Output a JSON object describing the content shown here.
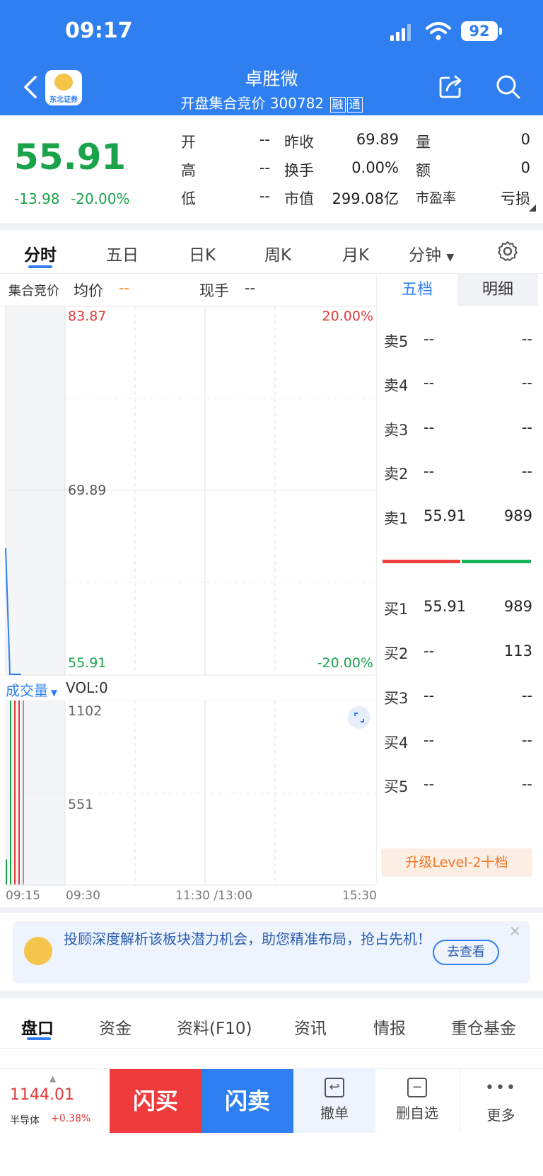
{
  "status_bar": {
    "time": "09:17",
    "battery": "92"
  },
  "header": {
    "title": "卓胜微",
    "subtitle": "开盘集合竞价 300782",
    "tag1": "融",
    "tag2": "通",
    "logo_text": "东北证券"
  },
  "quote": {
    "price": "55.91",
    "change": "-13.98",
    "change_pct": "-20.00%",
    "fields": {
      "open_label": "开",
      "open": "--",
      "high_label": "高",
      "high": "--",
      "low_label": "低",
      "low": "--",
      "prev_close_label": "昨收",
      "prev_close": "69.89",
      "turnover_label": "换手",
      "turnover": "0.00%",
      "mktcap_label": "市值",
      "mktcap": "299.08亿",
      "volume_label": "量",
      "volume": "0",
      "amount_label": "额",
      "amount": "0",
      "pe_label": "市盈率",
      "pe": "亏损"
    }
  },
  "tabs": [
    "分时",
    "五日",
    "日K",
    "周K",
    "月K",
    "分钟"
  ],
  "chart_info": {
    "auction_label": "集合竞价",
    "avg_label": "均价",
    "avg_value": "--",
    "hand_label": "现手",
    "hand_value": "--"
  },
  "chart_data": {
    "type": "line",
    "y_left_ticks": [
      "83.87",
      "69.89",
      "55.91"
    ],
    "y_right_ticks": [
      "20.00%",
      "-20.00%"
    ],
    "x_ticks": [
      "09:15",
      "09:30",
      "11:30 /13:00",
      "15:30"
    ],
    "ylim": [
      55.91,
      83.87
    ],
    "series": [
      {
        "values": [
          65.5,
          55.91
        ]
      }
    ],
    "volume": {
      "label": "成交量",
      "vol_text": "VOL:0",
      "ticks": [
        "1102",
        "551"
      ],
      "ylim": [
        0,
        1102
      ],
      "bars": [
        {
          "value": 150,
          "color": "#1aa34a"
        },
        {
          "value": 1102,
          "color": "#1aa34a"
        },
        {
          "value": 1102,
          "color": "#e13b3b"
        },
        {
          "value": 1102,
          "color": "#e13b3b"
        },
        {
          "value": 1102,
          "color": "#999999"
        }
      ]
    }
  },
  "orderbook": {
    "tab_five": "五档",
    "tab_detail": "明细",
    "sells": [
      {
        "label": "卖5",
        "price": "--",
        "vol": "--"
      },
      {
        "label": "卖4",
        "price": "--",
        "vol": "--"
      },
      {
        "label": "卖3",
        "price": "--",
        "vol": "--"
      },
      {
        "label": "卖2",
        "price": "--",
        "vol": "--"
      },
      {
        "label": "卖1",
        "price": "55.91",
        "vol": "989"
      }
    ],
    "buys": [
      {
        "label": "买1",
        "price": "55.91",
        "vol": "989"
      },
      {
        "label": "买2",
        "price": "--",
        "vol": "113"
      },
      {
        "label": "买3",
        "price": "--",
        "vol": "--"
      },
      {
        "label": "买4",
        "price": "--",
        "vol": "--"
      },
      {
        "label": "买5",
        "price": "--",
        "vol": "--"
      }
    ],
    "upgrade": "升级Level-2十档"
  },
  "promo": {
    "text": "投顾深度解析该板块潜力机会，助您精准布局，抢占先机！",
    "button": "去查看"
  },
  "bottom_tabs": [
    "盘口",
    "资金",
    "资料(F10)",
    "资讯",
    "情报",
    "重仓基金"
  ],
  "bottom_bar": {
    "index_value": "1144.01",
    "index_name": "半导体",
    "index_change": "+0.38%",
    "buy": "闪买",
    "sell": "闪卖",
    "cancel": "撤单",
    "remove_fav": "删自选",
    "more": "更多"
  },
  "colors": {
    "brand": "#2f7ff0",
    "up": "#e13b3b",
    "down": "#1aa34a"
  }
}
